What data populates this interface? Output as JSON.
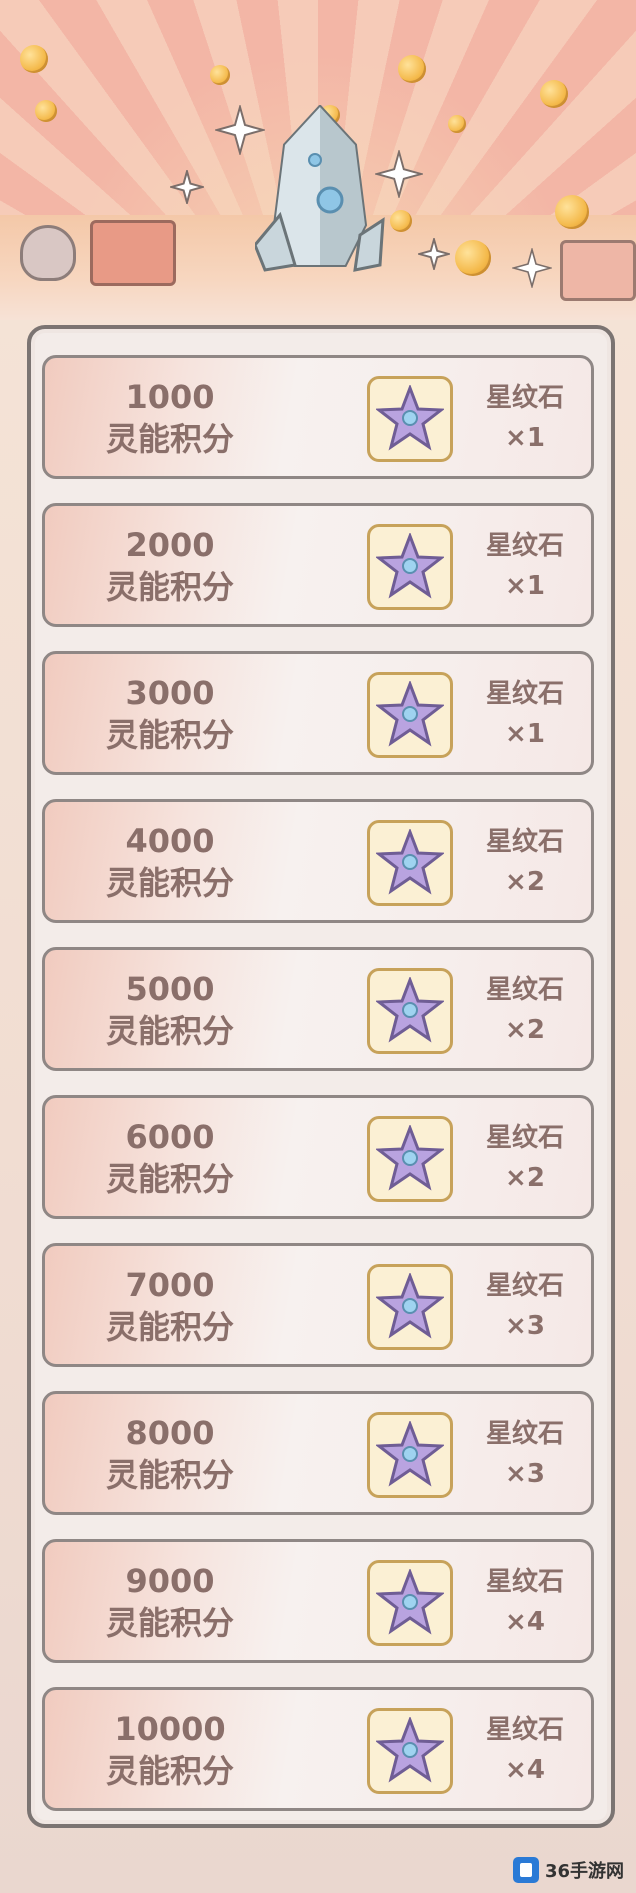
{
  "rewards": [
    {
      "points": "1000",
      "unit": "灵能积分",
      "item_name": "星纹石",
      "qty": "×1"
    },
    {
      "points": "2000",
      "unit": "灵能积分",
      "item_name": "星纹石",
      "qty": "×1"
    },
    {
      "points": "3000",
      "unit": "灵能积分",
      "item_name": "星纹石",
      "qty": "×1"
    },
    {
      "points": "4000",
      "unit": "灵能积分",
      "item_name": "星纹石",
      "qty": "×2"
    },
    {
      "points": "5000",
      "unit": "灵能积分",
      "item_name": "星纹石",
      "qty": "×2"
    },
    {
      "points": "6000",
      "unit": "灵能积分",
      "item_name": "星纹石",
      "qty": "×2"
    },
    {
      "points": "7000",
      "unit": "灵能积分",
      "item_name": "星纹石",
      "qty": "×3"
    },
    {
      "points": "8000",
      "unit": "灵能积分",
      "item_name": "星纹石",
      "qty": "×3"
    },
    {
      "points": "9000",
      "unit": "灵能积分",
      "item_name": "星纹石",
      "qty": "×4"
    },
    {
      "points": "10000",
      "unit": "灵能积分",
      "item_name": "星纹石",
      "qty": "×4"
    }
  ],
  "reward_icon": "star-stone-icon",
  "banner_icon": "crystal-icon",
  "watermark": {
    "text": "36手游网"
  },
  "colors": {
    "text": "#8a6f6a",
    "row_border": "#8f8785",
    "reward_frame": "#c7a25a",
    "star_fill": "#b9a3e0"
  }
}
